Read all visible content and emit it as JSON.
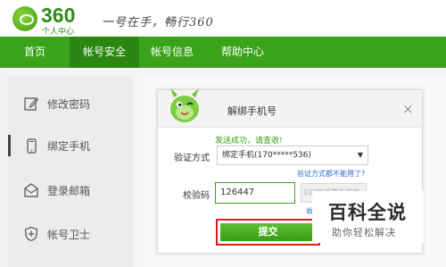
{
  "header": {
    "logo_number": "360",
    "logo_sub": "个人中心",
    "slogan": "一号在手，畅行360"
  },
  "nav": {
    "items": [
      {
        "label": "首页"
      },
      {
        "label": "帐号安全"
      },
      {
        "label": "帐号信息"
      },
      {
        "label": "帮助中心"
      }
    ],
    "active_index": 1
  },
  "sidebar": {
    "items": [
      {
        "label": "修改密码",
        "icon": "edit-icon"
      },
      {
        "label": "绑定手机",
        "icon": "phone-icon"
      },
      {
        "label": "登录邮箱",
        "icon": "mail-icon"
      },
      {
        "label": "帐号卫士",
        "icon": "shield-icon"
      }
    ],
    "active_index": 1
  },
  "modal": {
    "title": "解绑手机号",
    "success_msg": "发送成功，请查收!",
    "verify_method_label": "验证方式",
    "verify_method_value": "绑定手机(170*****536)",
    "verify_help_link": "验证方式都不能用了?",
    "code_label": "校验码",
    "code_value": "126447",
    "code_btn_text": "103秒后重新获取",
    "resend_link": "收",
    "submit_label": "提交",
    "close_symbol": "×"
  },
  "watermark": {
    "title": "百科全说",
    "subtitle": "助你轻松解决"
  },
  "colors": {
    "brand_green": "#3aa31a",
    "nav_active": "#2b8712",
    "link_blue": "#2a6fc9",
    "highlight_red": "#d81e1e"
  }
}
